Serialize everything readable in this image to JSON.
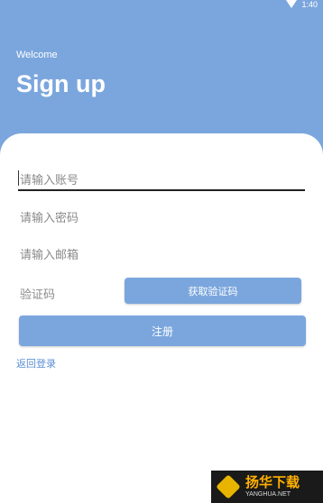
{
  "status_bar": {
    "time": "1:40",
    "wifi_icon": "wifi-icon"
  },
  "header": {
    "welcome": "Welcome",
    "title": "Sign up",
    "color": "#7ba6dd"
  },
  "form": {
    "account_placeholder": "请输入账号",
    "password_placeholder": "请输入密码",
    "email_placeholder": "请输入邮箱",
    "code_placeholder": "验证码",
    "get_code_label": "获取验证码",
    "register_label": "注册",
    "back_to_login": "返回登录"
  },
  "watermark": {
    "cn": "扬华下载",
    "en": "YANGHUA.NET"
  }
}
